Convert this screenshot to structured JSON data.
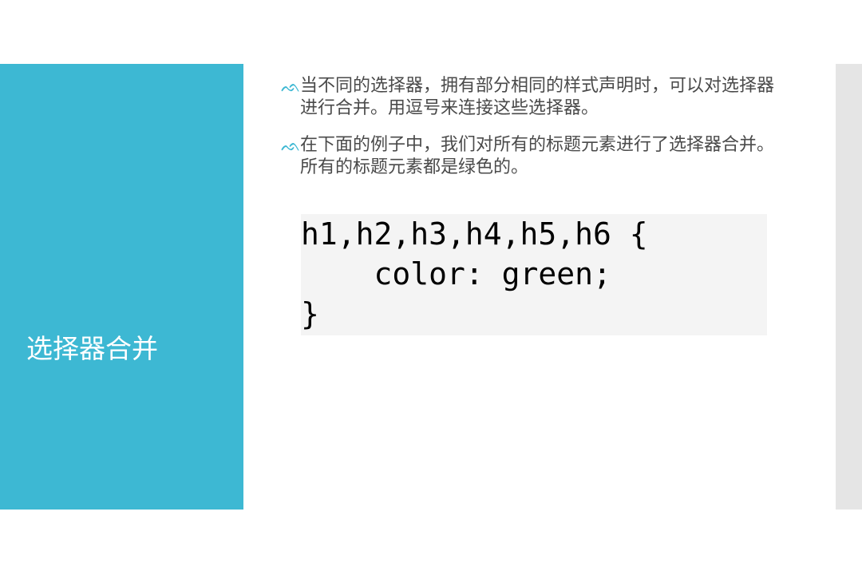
{
  "slide": {
    "title": "选择器合并",
    "bullets": [
      {
        "icon": "ornamental-bullet-icon",
        "glyph": "ᨒ",
        "text": "当不同的选择器，拥有部分相同的样式声明时，可以对选择器进行合并。用逗号来连接这些选择器。"
      },
      {
        "icon": "ornamental-bullet-icon",
        "glyph": "ᨒ",
        "text": "在下面的例子中，我们对所有的标题元素进行了选择器合并。所有的标题元素都是绿色的。"
      }
    ],
    "code_lines": [
      "h1,h2,h3,h4,h5,h6 {",
      "    color: green;",
      "}"
    ]
  },
  "colors": {
    "accent": "#3db8d3",
    "side_strip": "#e5e5e5",
    "code_background": "#f4f4f4",
    "body_text": "#4a4a4a"
  }
}
